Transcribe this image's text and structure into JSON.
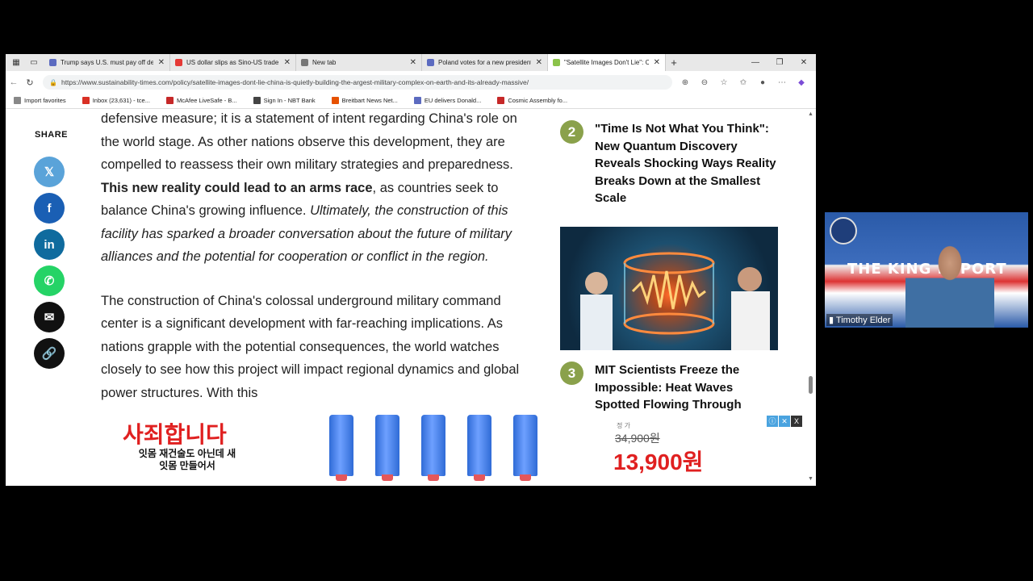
{
  "browser": {
    "tabs": [
      {
        "title": "Trump says U.S. must pay off deb",
        "color": "#5c6bc0",
        "active": false
      },
      {
        "title": "US dollar slips as Sino-US trade",
        "color": "#e53935",
        "active": false
      },
      {
        "title": "New tab",
        "color": "#777777",
        "active": false
      },
      {
        "title": "Poland votes for a new president",
        "color": "#5c6bc0",
        "active": false
      },
      {
        "title": "\"Satellite Images Don't Lie\": Chin",
        "color": "#8bc34a",
        "active": true
      }
    ],
    "new_tab": "+",
    "url": "https://www.sustainability-times.com/policy/satellite-images-dont-lie-china-is-quietly-building-the-argest-military-complex-on-earth-and-its-already-massive/",
    "bookmarks": [
      {
        "label": "Import favorites",
        "color": "#888888"
      },
      {
        "label": "Inbox (23,631) - tce...",
        "color": "#d93025"
      },
      {
        "label": "McAfee LiveSafe - B...",
        "color": "#c62828"
      },
      {
        "label": "Sign In - NBT Bank",
        "color": "#444444"
      },
      {
        "label": "Breitbart News Net...",
        "color": "#e65100"
      },
      {
        "label": "EU delivers Donald...",
        "color": "#5c6bc0"
      },
      {
        "label": "Cosmic Assembly fo...",
        "color": "#c62828"
      }
    ]
  },
  "share": {
    "label": "SHARE",
    "buttons": [
      {
        "name": "x-share",
        "glyph": "𝕏",
        "color": "#5aa3d9"
      },
      {
        "name": "facebook-share",
        "glyph": "f",
        "color": "#1a5fb4"
      },
      {
        "name": "linkedin-share",
        "glyph": "in",
        "color": "#0f6b9e"
      },
      {
        "name": "whatsapp-share",
        "glyph": "✆",
        "color": "#25d366"
      },
      {
        "name": "email-share",
        "glyph": "✉",
        "color": "#111111"
      },
      {
        "name": "link-share",
        "glyph": "🔗",
        "color": "#111111"
      }
    ]
  },
  "article": {
    "p1_a": "defensive measure; it is a statement of intent regarding China's role on the world stage. As other nations observe this development, they are compelled to reassess their own military strategies and preparedness. ",
    "p1_b": "This new reality could lead to an arms race",
    "p1_c": ", as countries seek to balance China's growing influence. ",
    "p1_d": "Ultimately, the construction of this facility has sparked a broader conversation about the future of military alliances and the potential for cooperation or conflict in the region.",
    "p2": "The construction of China's colossal underground military command center is a significant development with far-reaching implications. As nations grapple with the potential consequences, the world watches closely to see how this project will impact regional dynamics and global power structures. With this"
  },
  "sidebar": {
    "item2": {
      "rank": "2",
      "title": "\"Time Is Not What You Think\": New Quantum Discovery Reveals Shocking Ways Reality Breaks Down at the Smallest Scale"
    },
    "item3": {
      "rank": "3",
      "title": "MIT Scientists Freeze the Impossible: Heat Waves Spotted Flowing Through"
    }
  },
  "ad": {
    "headline": "사죄합니다",
    "sub": "잇몸 재건술도 아닌데 새 잇몸 만들어서",
    "price_label": "정 가",
    "old_price": "34,900원",
    "price": "13,900원"
  },
  "webcam": {
    "banner": "THE KING REPORT",
    "name": "Timothy Elder"
  }
}
